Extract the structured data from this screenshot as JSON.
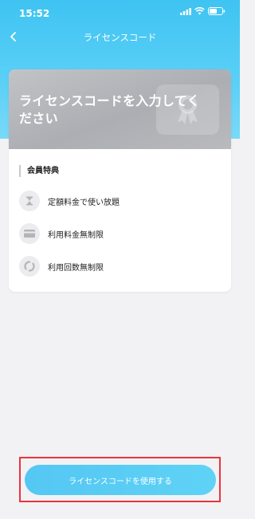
{
  "status_bar": {
    "time": "15:52"
  },
  "nav": {
    "title": "ライセンスコード"
  },
  "card": {
    "banner_text": "ライセンスコードを入力してください",
    "benefits_heading": "会員特典",
    "benefits": [
      {
        "label": "定額料金で使い放題",
        "icon": "hourglass-icon"
      },
      {
        "label": "利用料金無制限",
        "icon": "credit-card-icon"
      },
      {
        "label": "利用回数無制限",
        "icon": "refresh-icon"
      }
    ]
  },
  "cta": {
    "label": "ライセンスコードを使用する"
  },
  "colors": {
    "header_gradient_top": "#3fc3f2",
    "cta_blue": "#54c7f3",
    "highlight_red": "#e8343c",
    "banner_gray": "#b5b6bb"
  }
}
